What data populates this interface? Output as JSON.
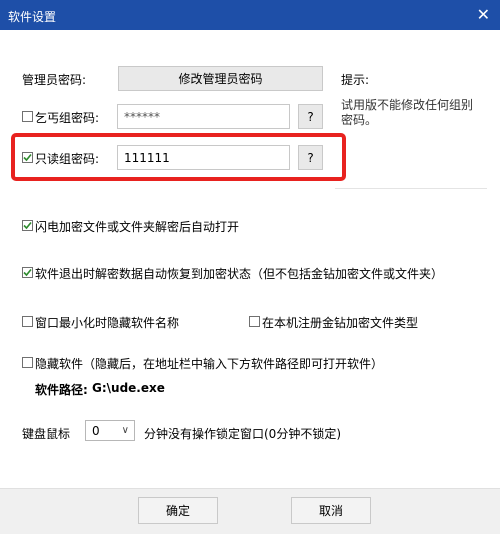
{
  "window": {
    "title": "软件设置",
    "close_glyph": "✕"
  },
  "admin": {
    "label": "管理员密码:",
    "button": "修改管理员密码"
  },
  "hint": {
    "title": "提示:",
    "text_line1": "试用版不能修改任何组别",
    "text_line2": "密码。"
  },
  "beggar": {
    "label": "乞丐组密码:",
    "value": "******",
    "help": "?",
    "checked": false
  },
  "readonly": {
    "label": "只读组密码:",
    "value": "111111",
    "help": "?",
    "checked": true
  },
  "options": {
    "flash_open": {
      "label": "闪电加密文件或文件夹解密后自动打开",
      "checked": true
    },
    "auto_restore": {
      "label": "软件退出时解密数据自动恢复到加密状态（但不包括金钻加密文件或文件夹）",
      "checked": true
    },
    "minimize_hide": {
      "label": "窗口最小化时隐藏软件名称",
      "checked": false
    },
    "register_type": {
      "label": "在本机注册金钻加密文件类型",
      "checked": false
    },
    "hide_software": {
      "label": "隐藏软件（隐藏后，在地址栏中输入下方软件路径即可打开软件）",
      "checked": false
    }
  },
  "software_path": {
    "label": "软件路径:",
    "value": "G:\\ude.exe"
  },
  "lock": {
    "label": "键盘鼠标",
    "value": "0",
    "suffix": "分钟没有操作锁定窗口(0分钟不锁定)"
  },
  "footer": {
    "ok": "确定",
    "cancel": "取消"
  },
  "colors": {
    "titlebar": "#1e4fa8",
    "highlight": "#e8221f",
    "check": "#2e8b2e"
  }
}
